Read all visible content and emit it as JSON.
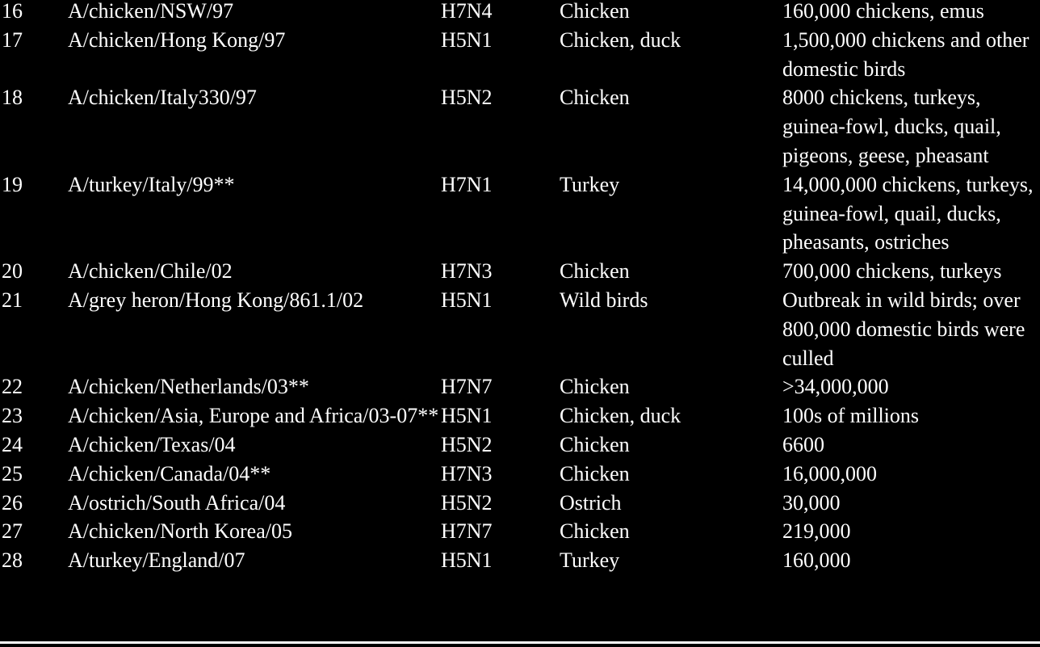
{
  "rows": [
    {
      "num": "16",
      "strain": "A/chicken/NSW/97",
      "subtype": "H7N4",
      "host": "Chicken",
      "loss": "160,000 chickens, emus"
    },
    {
      "num": "17",
      "strain": "A/chicken/Hong Kong/97",
      "subtype": "H5N1",
      "host": "Chicken, duck",
      "loss": "1,500,000 chickens and other domestic birds"
    },
    {
      "num": "18",
      "strain": "A/chicken/Italy330/97",
      "subtype": "H5N2",
      "host": "Chicken",
      "loss": "8000 chickens, turkeys, guinea-fowl, ducks, quail, pigeons, geese, pheasant"
    },
    {
      "num": "19",
      "strain": "A/turkey/Italy/99**",
      "subtype": "H7N1",
      "host": "Turkey",
      "loss": "14,000,000 chickens, turkeys, guinea-fowl, quail, ducks, pheasants, ostriches"
    },
    {
      "num": "20",
      "strain": "A/chicken/Chile/02",
      "subtype": "H7N3",
      "host": "Chicken",
      "loss": "700,000 chickens, turkeys"
    },
    {
      "num": "21",
      "strain": "A/grey heron/Hong Kong/861.1/02",
      "subtype": "H5N1",
      "host": "Wild birds",
      "loss": "Outbreak in wild birds; over 800,000 domestic birds were culled"
    },
    {
      "num": "22",
      "strain": "A/chicken/Netherlands/03**",
      "subtype": "H7N7",
      "host": "Chicken",
      "loss": ">34,000,000"
    },
    {
      "num": "23",
      "strain": "A/chicken/Asia, Europe and Africa/03-07**",
      "subtype": "H5N1",
      "host": "Chicken, duck",
      "loss": "100s of millions"
    },
    {
      "num": "24",
      "strain": "A/chicken/Texas/04",
      "subtype": "H5N2",
      "host": "Chicken",
      "loss": "6600"
    },
    {
      "num": "25",
      "strain": "A/chicken/Canada/04**",
      "subtype": "H7N3",
      "host": "Chicken",
      "loss": "16,000,000"
    },
    {
      "num": "26",
      "strain": "A/ostrich/South Africa/04",
      "subtype": "H5N2",
      "host": "Ostrich",
      "loss": "30,000"
    },
    {
      "num": "27",
      "strain": "A/chicken/North Korea/05",
      "subtype": "H7N7",
      "host": "Chicken",
      "loss": "219,000"
    },
    {
      "num": "28",
      "strain": "A/turkey/England/07",
      "subtype": "H5N1",
      "host": "Turkey",
      "loss": "160,000"
    }
  ]
}
